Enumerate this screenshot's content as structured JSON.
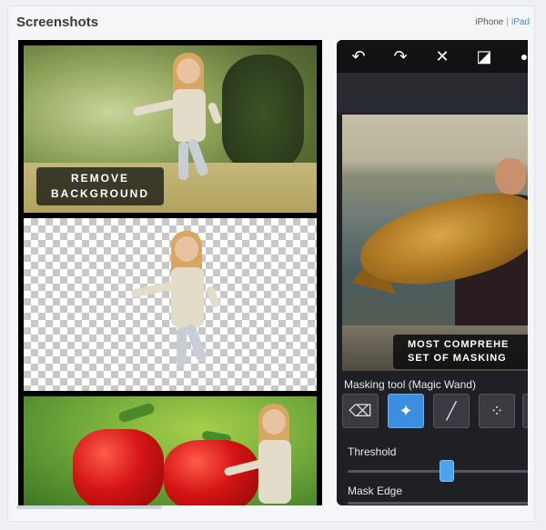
{
  "section": {
    "title": "Screenshots"
  },
  "devices": {
    "iphone": "iPhone",
    "separator": "|",
    "ipad": "iPad"
  },
  "shot1": {
    "badge_line1": "REMOVE",
    "badge_line2": "BACKGROUND"
  },
  "shot2": {
    "toolbar": [
      {
        "name": "undo-icon",
        "glyph": "↶"
      },
      {
        "name": "redo-icon",
        "glyph": "↷"
      },
      {
        "name": "close-icon",
        "glyph": "✕"
      },
      {
        "name": "invert-icon",
        "glyph": "◪"
      }
    ],
    "banner_line1": "MOST COMPREHE",
    "banner_line2": "SET OF MASKING",
    "masking_tool_label": "Masking tool (Magic Wand)",
    "tools": [
      {
        "name": "eraser-icon",
        "glyph": "⌫"
      },
      {
        "name": "magic-wand-icon",
        "glyph": "✦"
      },
      {
        "name": "brush-icon",
        "glyph": "╱"
      },
      {
        "name": "spray-brush-icon",
        "glyph": "⁘"
      }
    ],
    "threshold_label": "Threshold",
    "threshold_value": 0.55,
    "mask_edge_label": "Mask Edge"
  }
}
